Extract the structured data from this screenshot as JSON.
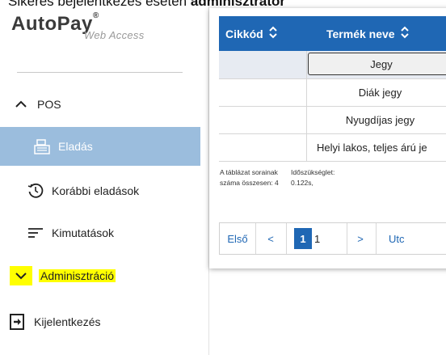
{
  "caption": {
    "text_before": "Sikeres bejelentkezés esetén ",
    "text_bold": "adminisztrátor"
  },
  "logo": {
    "brand": "AutoPay",
    "reg": "®",
    "subtitle": "Web Access"
  },
  "sidebar": {
    "pos": {
      "label": "POS",
      "icon": "chevron-up-icon"
    },
    "eladas": {
      "label": "Eladás",
      "icon": "cash-register-icon"
    },
    "korabbi": {
      "label": "Korábbi eladások",
      "icon": "history-icon"
    },
    "kimutatasok": {
      "label": "Kimutatások",
      "icon": "list-lines-icon"
    },
    "admin": {
      "label": "Adminisztráció",
      "icon": "chevron-down-icon",
      "highlight": "#ffff00"
    },
    "logout": {
      "label": "Kijelentkezés",
      "icon": "logout-icon"
    },
    "active_color": "#9bbddd"
  },
  "table": {
    "header_color": "#1f67b4",
    "columns": [
      "Cikkód",
      "Termék neve"
    ],
    "filter_value": "Jegy",
    "rows": [
      {
        "code": "",
        "name": "Diák jegy"
      },
      {
        "code": "",
        "name": "Nyugdíjas jegy"
      },
      {
        "code": "",
        "name": "Helyi lakos, teljes árú je"
      }
    ],
    "row_count_label": "A táblázat sorainak száma összesen: 4",
    "time_label": "Időszükséglet: 0.122s,"
  },
  "pager": {
    "first": "Első",
    "prev": "<",
    "current": "1",
    "total": "1",
    "next": ">",
    "last": "Utc"
  }
}
